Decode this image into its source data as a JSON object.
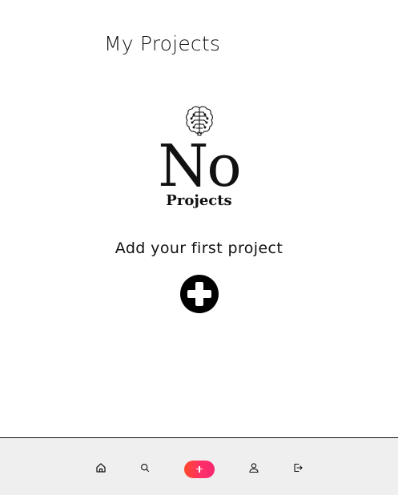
{
  "header": {
    "title": "My Projects"
  },
  "empty_state": {
    "icon": "brain-icon",
    "title": "No",
    "subtitle": "Projects",
    "cta_text": "Add your first project",
    "add_icon": "plus-circle-icon"
  },
  "bottom_nav": {
    "items": [
      {
        "icon": "home-icon"
      },
      {
        "icon": "search-icon"
      },
      {
        "icon": "plus-icon",
        "accent": "#ff3366"
      },
      {
        "icon": "user-icon"
      },
      {
        "icon": "logout-icon"
      }
    ]
  },
  "colors": {
    "background": "#ffffff",
    "text": "#111111",
    "nav_background": "#efefef",
    "accent_gradient_start": "#ff4a2a",
    "accent_gradient_end": "#f6286e"
  }
}
